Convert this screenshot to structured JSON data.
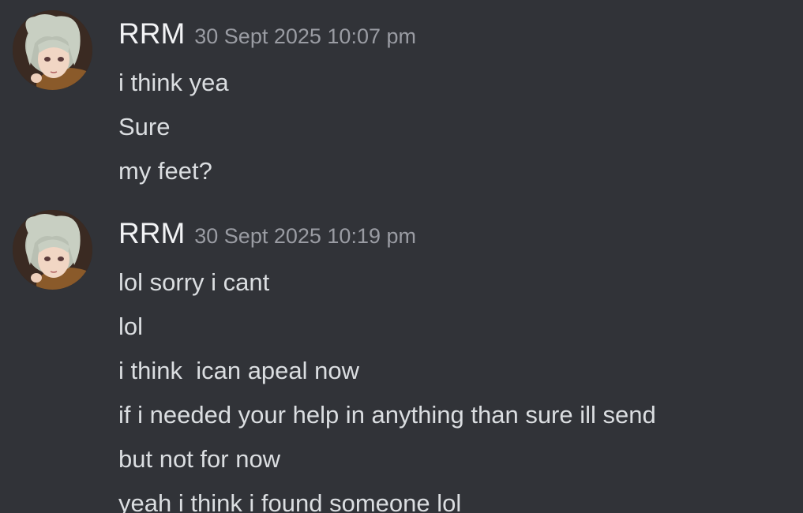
{
  "messages": [
    {
      "author": "RRM",
      "timestamp": "30 Sept 2025 10:07 pm",
      "lines": [
        "i think yea",
        "Sure",
        "my feet?"
      ]
    },
    {
      "author": "RRM",
      "timestamp": "30 Sept 2025 10:19 pm",
      "lines": [
        "lol sorry i cant",
        "lol",
        "i think  ican apeal now",
        "if i needed your help in anything than sure ill send",
        "but not for now",
        "yeah i think i found someone lol"
      ]
    }
  ],
  "colors": {
    "background": "#313338",
    "username": "#f2f3f5",
    "timestamp": "#9a9ca3",
    "message_text": "#dbdee1"
  },
  "icons": {
    "avatar": "anime-girl-avatar"
  }
}
